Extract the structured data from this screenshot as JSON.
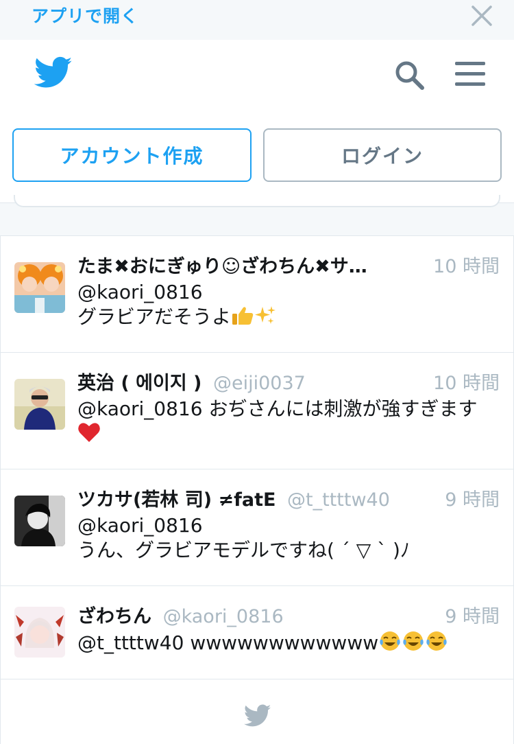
{
  "app_banner": {
    "open_in_app": "アプリで開く"
  },
  "header": {
    "brand_icon": "twitter-bird-icon",
    "search_icon": "search-icon",
    "menu_icon": "hamburger-menu-icon"
  },
  "auth": {
    "signup_label": "アカウント作成",
    "login_label": "ログイン"
  },
  "colors": {
    "accent": "#1da1f2",
    "muted": "#aab8c2",
    "text": "#14171a",
    "divider": "#e1e8ed"
  },
  "tweets": [
    {
      "name": "たま✖おにぎゅり☺ざわちん✖サ…",
      "handle": "",
      "time": "10 時間",
      "reply_to": "@kaori_0816",
      "text": "グラビアだそうよ",
      "emojis": [
        "thumbs-up",
        "sparkles"
      ]
    },
    {
      "name": "英治 ( 에이지 )",
      "handle": "@eiji0037",
      "time": "10 時間",
      "reply_to": "@kaori_0816",
      "text": " おぢさんには刺激が強すぎます",
      "emojis": [
        "red-heart"
      ]
    },
    {
      "name": "ツカサ(若林 司) ≠fatE",
      "handle": "@t_ttttw40",
      "time": "9 時間",
      "reply_to": "@kaori_0816",
      "text": "うん、グラビアモデルですね( ´ ▽ ` )ﾉ",
      "emojis": []
    },
    {
      "name": "ざわちん",
      "handle": "@kaori_0816",
      "time": "9 時間",
      "reply_to": "@t_ttttw40",
      "text": " wwwwwwwwwwww",
      "emojis": [
        "tears-of-joy",
        "tears-of-joy",
        "tears-of-joy"
      ]
    }
  ],
  "footer": {
    "icon": "twitter-bird-icon"
  }
}
